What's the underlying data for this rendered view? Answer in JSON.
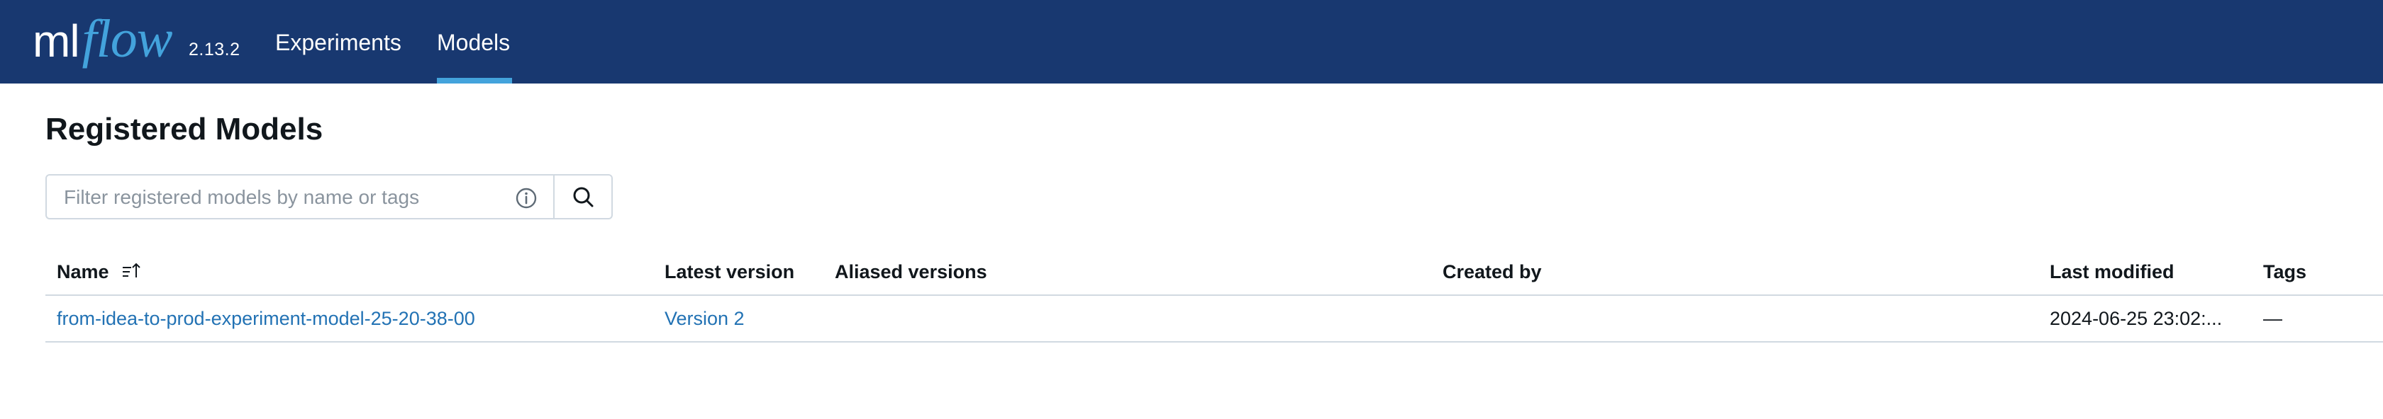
{
  "header": {
    "logo_ml": "ml",
    "logo_flow": "flow",
    "version": "2.13.2",
    "nav": [
      {
        "label": "Experiments",
        "active": false
      },
      {
        "label": "Models",
        "active": true
      }
    ],
    "colors": {
      "background": "#183870",
      "accent": "#43a3dc"
    }
  },
  "main": {
    "title": "Registered Models",
    "search": {
      "placeholder": "Filter registered models by name or tags",
      "value": "",
      "info_icon": "info-icon",
      "button_icon": "search-icon"
    },
    "table": {
      "columns": [
        "Name",
        "Latest version",
        "Aliased versions",
        "Created by",
        "Last modified",
        "Tags"
      ],
      "sort_icon": "sort-ascending-icon",
      "rows": [
        {
          "name": "from-idea-to-prod-experiment-model-25-20-38-00",
          "latest_version": "Version 2",
          "aliased_versions": "",
          "created_by": "",
          "last_modified": "2024-06-25 23:02:...",
          "tags": "—"
        }
      ]
    }
  }
}
